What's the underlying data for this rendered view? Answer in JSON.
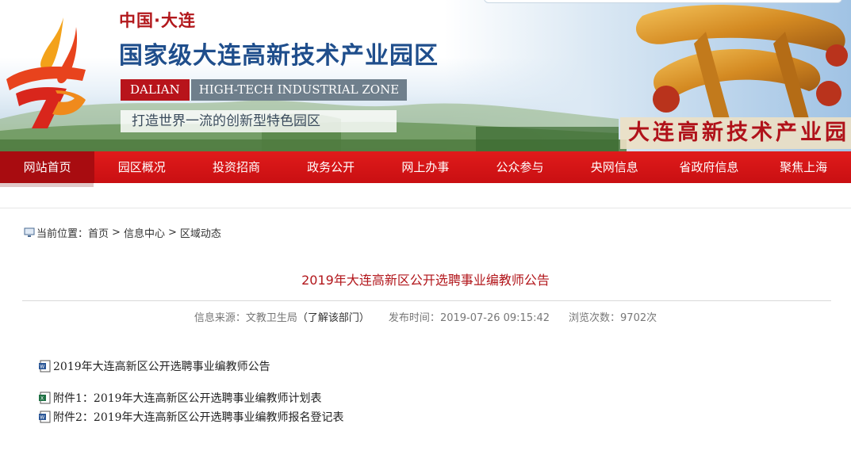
{
  "header": {
    "slogan_small": "中国·大连",
    "site_title": "国家级大连高新技术产业园区",
    "zone_dalian": "DALIAN",
    "zone_en": "HIGH-TECH INDUSTRIAL ZONE",
    "tagline": "打造世界一流的创新型特色园区",
    "calligraphy": "大连高新技术产业园"
  },
  "nav": {
    "items": [
      {
        "label": "网站首页"
      },
      {
        "label": "园区概况"
      },
      {
        "label": "投资招商"
      },
      {
        "label": "政务公开"
      },
      {
        "label": "网上办事"
      },
      {
        "label": "公众参与"
      },
      {
        "label": "央网信息"
      },
      {
        "label": "省政府信息"
      },
      {
        "label": "聚焦上海"
      }
    ],
    "active_index": 0
  },
  "breadcrumb": {
    "prefix": "当前位置：",
    "items": [
      "首页",
      "信息中心",
      "区域动态"
    ],
    "separator": ">"
  },
  "article": {
    "title": "2019年大连高新区公开选聘事业编教师公告",
    "source_label": "信息来源：",
    "source_value": "文教卫生局",
    "dept_link": "（了解该部门）",
    "publish_label": "发布时间：",
    "publish_value": "2019-07-26 09:15:42",
    "views_label": "浏览次数：",
    "views_value": "9702次"
  },
  "attachments": [
    {
      "label": "2019年大连高新区公开选聘事业编教师公告",
      "icon": "word-doc-icon"
    },
    {
      "label": "附件1：2019年大连高新区公开选聘事业编教师计划表",
      "icon": "excel-doc-icon"
    },
    {
      "label": "附件2：2019年大连高新区公开选聘事业编教师报名登记表",
      "icon": "word-doc-icon"
    }
  ],
  "colors": {
    "nav_red": "#d41417",
    "title_red": "#b2161b",
    "brand_blue": "#1f4e8c"
  }
}
